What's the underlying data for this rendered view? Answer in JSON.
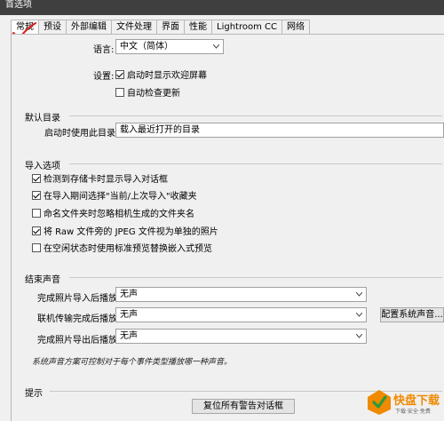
{
  "window": {
    "title": "首选项"
  },
  "tabs": [
    "常规",
    "预设",
    "外部编辑",
    "文件处理",
    "界面",
    "性能",
    "Lightroom CC",
    "网络"
  ],
  "language": {
    "label": "语言:",
    "value": "中文（简体）"
  },
  "settings": {
    "label": "设置:",
    "options": [
      {
        "label": "启动时显示欢迎屏幕",
        "checked": true
      },
      {
        "label": "自动检查更新",
        "checked": false
      }
    ]
  },
  "default_catalog": {
    "heading": "默认目录",
    "label": "启动时使用此目录:",
    "value": "载入最近打开的目录"
  },
  "import_options": {
    "heading": "导入选项",
    "options": [
      {
        "label": "检测到存储卡时显示导入对话框",
        "checked": true
      },
      {
        "label": "在导入期间选择\"当前/上次导入\"收藏夹",
        "checked": true
      },
      {
        "label": "命名文件夹时忽略相机生成的文件夹名",
        "checked": false
      },
      {
        "label": "将 Raw 文件旁的 JPEG 文件视为单独的照片",
        "checked": true
      },
      {
        "label": "在空闲状态时使用标准预览替换嵌入式预览",
        "checked": false
      }
    ]
  },
  "completion_sounds": {
    "heading": "结束声音",
    "rows": [
      {
        "label": "完成照片导入后播放:",
        "value": "无声"
      },
      {
        "label": "联机传输完成后播放:",
        "value": "无声"
      },
      {
        "label": "完成照片导出后播放:",
        "value": "无声"
      }
    ],
    "configure_button": "配置系统声音...",
    "note": "系统声音方案可控制对于每个事件类型播放哪一种声音。"
  },
  "prompts": {
    "heading": "提示",
    "reset_button": "复位所有警告对话框"
  },
  "watermark": {
    "main": "快盘下载",
    "sub": "下载·安全·免费"
  },
  "colors": {
    "check_mark": "#000000",
    "annotation": "#d9231f",
    "logo_orange": "#f08a00",
    "logo_green": "#2f9a3a"
  }
}
